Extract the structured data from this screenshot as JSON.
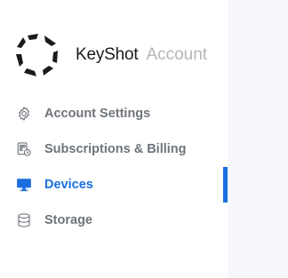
{
  "brand": {
    "name": "KeyShot",
    "suffix": "Account",
    "logo_icon": "keyshot-logo"
  },
  "colors": {
    "accent": "#1a6fe0",
    "muted_text": "#6f747c",
    "main_background": "#f5f7fa"
  },
  "sidebar": {
    "items": [
      {
        "label": "Account Settings",
        "icon": "gear-icon",
        "active": false
      },
      {
        "label": "Subscriptions & Billing",
        "icon": "billing-icon",
        "active": false
      },
      {
        "label": "Devices",
        "icon": "monitor-icon",
        "active": true
      },
      {
        "label": "Storage",
        "icon": "database-icon",
        "active": false
      }
    ]
  }
}
